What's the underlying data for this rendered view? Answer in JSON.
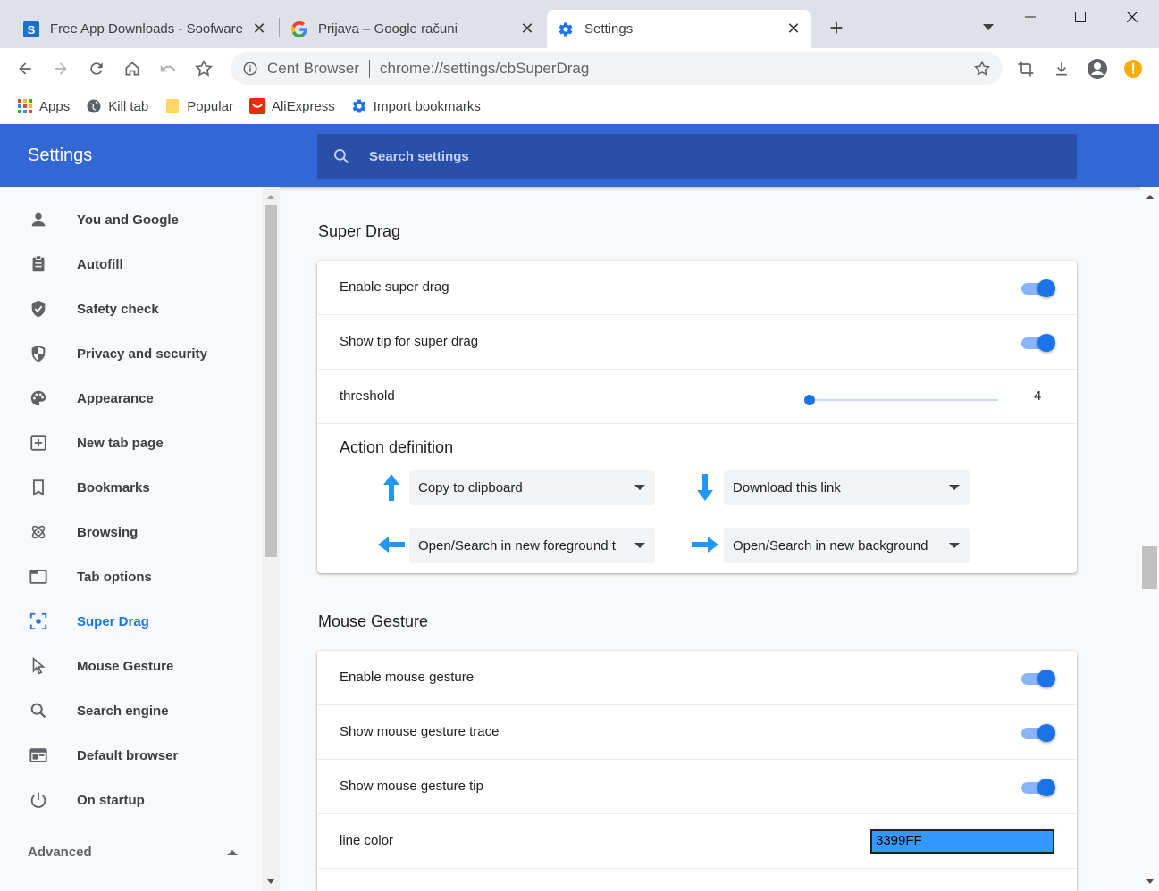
{
  "browser": {
    "tabs": [
      {
        "title": "Free App Downloads - Soofware",
        "icon": "soofware-s-icon"
      },
      {
        "title": "Prijava – Google računi",
        "icon": "google-g-icon"
      },
      {
        "title": "Settings",
        "icon": "settings-gear-icon",
        "active": true
      }
    ],
    "omnibox": {
      "host": "Cent Browser",
      "url": "chrome://settings/cbSuperDrag"
    },
    "bookmarks": [
      {
        "label": "Apps",
        "icon": "apps-grid-icon"
      },
      {
        "label": "Kill tab",
        "icon": "globe-icon"
      },
      {
        "label": "Popular",
        "icon": "folder-icon"
      },
      {
        "label": "AliExpress",
        "icon": "aliexpress-icon"
      },
      {
        "label": "Import bookmarks",
        "icon": "settings-gear-icon"
      }
    ]
  },
  "settings": {
    "title": "Settings",
    "search_placeholder": "Search settings",
    "nav": [
      {
        "label": "You and Google",
        "icon": "person-icon"
      },
      {
        "label": "Autofill",
        "icon": "clipboard-icon"
      },
      {
        "label": "Safety check",
        "icon": "shield-check-icon"
      },
      {
        "label": "Privacy and security",
        "icon": "shield-icon"
      },
      {
        "label": "Appearance",
        "icon": "palette-icon"
      },
      {
        "label": "New tab page",
        "icon": "new-tab-icon"
      },
      {
        "label": "Bookmarks",
        "icon": "bookmark-icon"
      },
      {
        "label": "Browsing",
        "icon": "atom-icon"
      },
      {
        "label": "Tab options",
        "icon": "tab-icon"
      },
      {
        "label": "Super Drag",
        "icon": "super-drag-icon",
        "active": true
      },
      {
        "label": "Mouse Gesture",
        "icon": "cursor-icon"
      },
      {
        "label": "Search engine",
        "icon": "search-icon"
      },
      {
        "label": "Default browser",
        "icon": "browser-window-icon"
      },
      {
        "label": "On startup",
        "icon": "power-icon"
      }
    ],
    "advanced_label": "Advanced"
  },
  "super_drag": {
    "title": "Super Drag",
    "enable_label": "Enable super drag",
    "enable_on": true,
    "show_tip_label": "Show tip for super drag",
    "show_tip_on": true,
    "threshold_label": "threshold",
    "threshold_value": "4",
    "threshold_fraction": 0.0,
    "action_title": "Action definition",
    "actions": {
      "up": "Copy to clipboard",
      "down": "Download this link",
      "left": "Open/Search in new foreground t",
      "right": "Open/Search in new background"
    }
  },
  "mouse_gesture": {
    "title": "Mouse Gesture",
    "enable_label": "Enable mouse gesture",
    "enable_on": true,
    "trace_label": "Show mouse gesture trace",
    "trace_on": true,
    "tip_label": "Show mouse gesture tip",
    "tip_on": true,
    "line_color_label": "line color",
    "line_color_value": "3399FF"
  },
  "colors": {
    "accent": "#1a73e8",
    "header": "#3367d6",
    "line_color": "#3399FF"
  }
}
